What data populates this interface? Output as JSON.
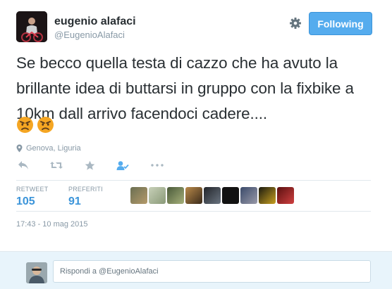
{
  "user": {
    "name": "eugenio alafaci",
    "handle": "@EugenioAlafaci"
  },
  "follow_button": {
    "label": "Following"
  },
  "tweet": {
    "text": "Se becco quella testa di cazzo che ha avuto la brillante idea di buttarsi in gruppo con la fixbike a 10km dall arrivo facendoci cadere....",
    "emojis": [
      "angry-face",
      "angry-face"
    ]
  },
  "location": {
    "icon": "map-pin-icon",
    "label": "Genova, Liguria"
  },
  "actions": [
    "reply-icon",
    "retweet-icon",
    "favorite-icon",
    "follow-icon",
    "more-icon"
  ],
  "stats": {
    "retweets": {
      "label": "RETWEET",
      "value": "105"
    },
    "favorites": {
      "label": "PREFERITI",
      "value": "91"
    }
  },
  "timestamp": "17:43 - 10 mag 2015",
  "reply": {
    "placeholder": "Rispondi a @EugenioAlafaci"
  },
  "colors": {
    "accent": "#55acee",
    "link": "#3b94d9",
    "muted": "#8899a6"
  }
}
